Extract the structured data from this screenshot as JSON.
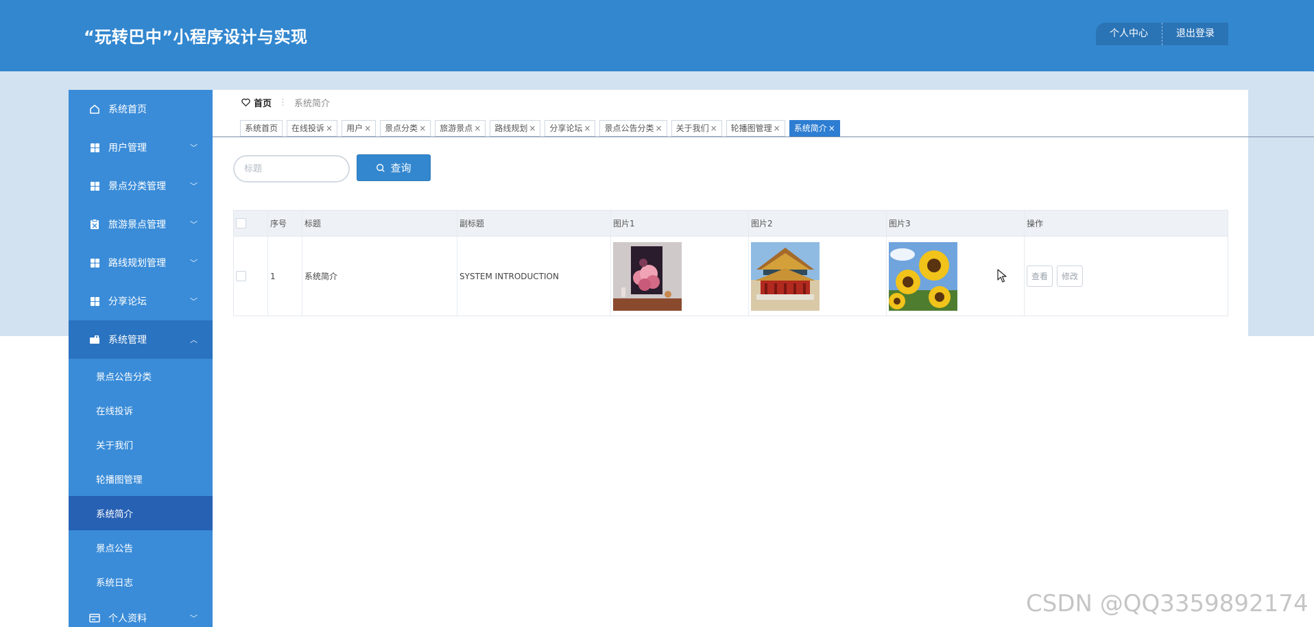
{
  "header": {
    "title": "“玩转巴中”小程序设计与实现",
    "profile_label": "个人中心",
    "logout_label": "退出登录"
  },
  "sidebar": {
    "items": [
      {
        "label": "系统首页",
        "icon": "home-icon",
        "expandable": false
      },
      {
        "label": "用户管理",
        "icon": "grid-icon",
        "expandable": true
      },
      {
        "label": "景点分类管理",
        "icon": "grid-icon",
        "expandable": true
      },
      {
        "label": "旅游景点管理",
        "icon": "clipboard-icon",
        "expandable": true
      },
      {
        "label": "路线规划管理",
        "icon": "grid-icon",
        "expandable": true
      },
      {
        "label": "分享论坛",
        "icon": "grid-icon",
        "expandable": true
      },
      {
        "label": "系统管理",
        "icon": "briefcase-icon",
        "expandable": true,
        "expanded": true
      }
    ],
    "sub_items": [
      "景点公告分类",
      "在线投诉",
      "关于我们",
      "轮播图管理",
      "系统简介",
      "景点公告",
      "系统日志"
    ],
    "active_sub_item": "系统简介",
    "last_item": {
      "label": "个人资料",
      "icon": "id-card-icon"
    }
  },
  "breadcrumb": {
    "home": "首页",
    "current": "系统简介"
  },
  "tabs": [
    {
      "label": "系统首页",
      "closable": false
    },
    {
      "label": "在线投诉",
      "closable": true
    },
    {
      "label": "用户",
      "closable": true
    },
    {
      "label": "景点分类",
      "closable": true
    },
    {
      "label": "旅游景点",
      "closable": true
    },
    {
      "label": "路线规划",
      "closable": true
    },
    {
      "label": "分享论坛",
      "closable": true
    },
    {
      "label": "景点公告分类",
      "closable": true
    },
    {
      "label": "关于我们",
      "closable": true
    },
    {
      "label": "轮播图管理",
      "closable": true
    },
    {
      "label": "系统简介",
      "closable": true,
      "active": true
    }
  ],
  "search": {
    "placeholder": "标题",
    "value": "",
    "button_label": "查询"
  },
  "table": {
    "headers": [
      "序号",
      "标题",
      "副标题",
      "图片1",
      "图片2",
      "图片3",
      "操作"
    ],
    "rows": [
      {
        "index": "1",
        "title": "系统简介",
        "subtitle": "SYSTEM INTRODUCTION",
        "images": [
          "pink-cloud-art-image",
          "imperial-palace-image",
          "sunflowers-image"
        ],
        "actions": [
          "查看",
          "修改"
        ]
      }
    ]
  },
  "watermark": "CSDN @QQ3359892174",
  "colors": {
    "primary": "#3387cf",
    "sidebar": "#3a8cd8",
    "sidebar_active": "#2761b4",
    "band": "#d3e2f0"
  }
}
